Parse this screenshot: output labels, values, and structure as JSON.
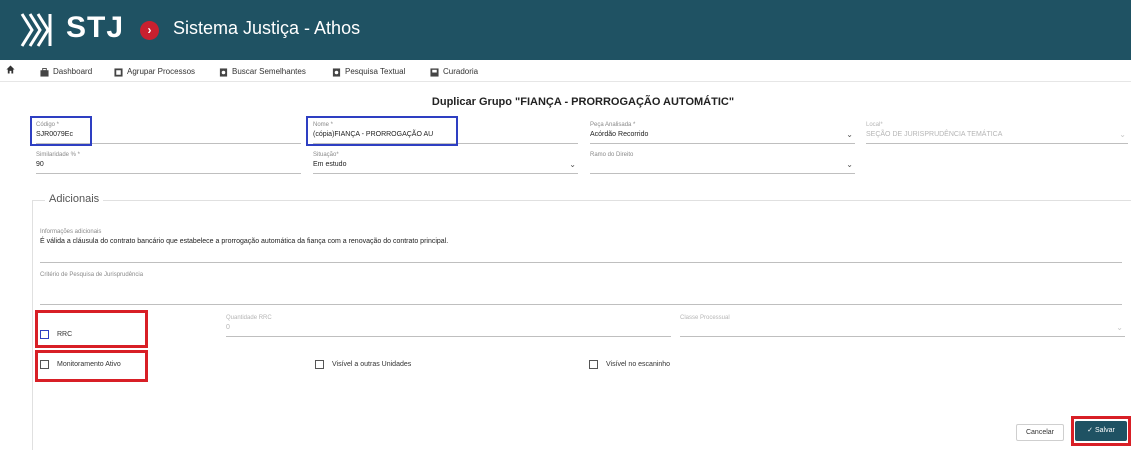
{
  "header": {
    "logo_text": "STJ",
    "app_title": "Sistema Justiça - Athos",
    "colors": {
      "bar": "#1f5263",
      "accent": "#c9202f"
    }
  },
  "nav": {
    "home_icon": "home-icon",
    "items": [
      {
        "label": "Dashboard",
        "icon": "briefcase-icon"
      },
      {
        "label": "Agrupar Processos",
        "icon": "group-icon"
      },
      {
        "label": "Buscar Semelhantes",
        "icon": "document-search-icon"
      },
      {
        "label": "Pesquisa Textual",
        "icon": "document-search-icon"
      },
      {
        "label": "Curadoria",
        "icon": "folder-icon"
      }
    ]
  },
  "form": {
    "title": "Duplicar Grupo \"FIANÇA - PRORROGAÇÃO AUTOMÁTIC\"",
    "codigo": {
      "label": "Código *",
      "value": "SJR0079Ec"
    },
    "nome": {
      "label": "Nome *",
      "value": "(cópia)FIANÇA - PRORROGAÇÃO AU"
    },
    "peca": {
      "label": "Peça Analisada *",
      "value": "Acórdão Recorrido"
    },
    "local": {
      "label": "Local*",
      "value": "SEÇÃO DE JURISPRUDÊNCIA TEMÁTICA"
    },
    "similaridade": {
      "label": "Similaridade % *",
      "value": "90"
    },
    "situacao": {
      "label": "Situação*",
      "value": "Em estudo"
    },
    "ramo": {
      "label": "Ramo do Direito",
      "value": ""
    }
  },
  "adicionais": {
    "legend": "Adicionais",
    "info_label": "Informações adicionais",
    "info_value": "É válida a cláusula do contrato bancário que estabelece a prorrogação automática da fiança com a renovação do contrato principal.",
    "criterio_label": "Critério de Pesquisa de Jurisprudência",
    "criterio_value": "",
    "rrc_label": "RRC",
    "quantidade_label": "Quantidade RRC",
    "quantidade_value": "0",
    "classe_label": "Classe Processual",
    "monitoramento_label": "Monitoramento Ativo",
    "visivel_unidades_label": "Visível a outras Unidades",
    "visivel_escaninho_label": "Visível no escaninho"
  },
  "actions": {
    "cancel_label": "Cancelar",
    "save_label": "Salvar"
  }
}
